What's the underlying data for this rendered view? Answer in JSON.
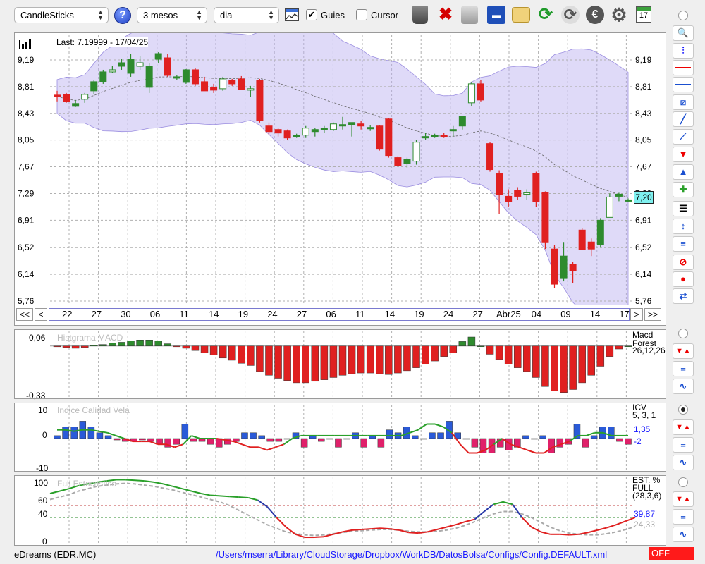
{
  "toolbar": {
    "chart_type": "CandleSticks",
    "help_icon_label": "?",
    "period": "3 mesos",
    "interval": "dia",
    "guides_label": "Guies",
    "guides_checked": true,
    "cursor_label": "Cursor",
    "cursor_checked": false,
    "calendar_day": "17"
  },
  "main_chart": {
    "last_label": "Last: 7.19999 - 17/04/25",
    "current_value": "7,20",
    "y_ticks": [
      "9,19",
      "8,81",
      "8,43",
      "8,05",
      "7,67",
      "7,29",
      "6,91",
      "6,52",
      "6,14",
      "5,76"
    ],
    "x_ticks": [
      "22",
      "27",
      "30",
      "06",
      "11",
      "14",
      "19",
      "24",
      "27",
      "06",
      "11",
      "14",
      "19",
      "24",
      "27",
      "Abr25",
      "04",
      "09",
      "14",
      "17"
    ],
    "nav": {
      "first": "<<",
      "prev": "<",
      "next": ">",
      "last": ">>"
    }
  },
  "macd": {
    "title": "Histgrama MACD",
    "y_top": "0,06",
    "y_bottom": "-0,33",
    "side_name": "Macd\nForest",
    "side_params": "26,12,26"
  },
  "icv": {
    "title": "Indice Calidad Vela",
    "y_top": "10",
    "y_mid": "0",
    "y_bottom": "-10",
    "side_name": "ICV",
    "side_params": "5, 3, 1",
    "value1": "1,35",
    "value2": "-2"
  },
  "stoch": {
    "title": "Full Estocastico",
    "y_ticks": [
      "100",
      "60",
      "40",
      "0"
    ],
    "side_name": "EST. %",
    "side_name2": "FULL",
    "side_params": "(28,3,6)",
    "value1": "39,87",
    "value2": "24,33"
  },
  "status": {
    "ticker": "eDreams (EDR.MC)",
    "path": "/Users/mserra/Library/CloudStorage/Dropbox/WorkDB/DatosBolsa/Configs/Config.DEFAULT.xml",
    "off_label": "OFF"
  },
  "colors": {
    "up": "#2e8b2e",
    "down": "#e02020",
    "band": "#b9aef0",
    "accent_blue": "#1a1aff"
  },
  "chart_data": [
    {
      "type": "candlestick",
      "title": "",
      "ylim": [
        5.76,
        9.37
      ],
      "candles": [
        [
          8.69,
          8.75,
          8.6,
          8.67
        ],
        [
          8.7,
          8.72,
          8.58,
          8.6
        ],
        [
          8.53,
          8.62,
          8.52,
          8.57
        ],
        [
          8.63,
          8.72,
          8.58,
          8.7
        ],
        [
          8.75,
          8.9,
          8.7,
          8.88
        ],
        [
          8.88,
          9.05,
          8.85,
          9.02
        ],
        [
          9.02,
          9.1,
          9.0,
          9.05
        ],
        [
          9.1,
          9.2,
          9.05,
          9.15
        ],
        [
          9.0,
          9.28,
          8.95,
          9.2
        ],
        [
          9.1,
          9.25,
          9.05,
          9.15
        ],
        [
          8.8,
          9.15,
          8.72,
          9.1
        ],
        [
          9.2,
          9.3,
          9.15,
          9.28
        ],
        [
          9.22,
          9.27,
          8.95,
          8.97
        ],
        [
          8.94,
          8.97,
          8.9,
          8.95
        ],
        [
          8.87,
          9.06,
          8.85,
          9.05
        ],
        [
          9.05,
          9.07,
          8.82,
          8.85
        ],
        [
          8.88,
          8.95,
          8.75,
          8.75
        ],
        [
          8.8,
          8.85,
          8.72,
          8.76
        ],
        [
          8.78,
          8.95,
          8.75,
          8.92
        ],
        [
          8.9,
          8.92,
          8.82,
          8.85
        ],
        [
          8.92,
          8.96,
          8.76,
          8.77
        ],
        [
          8.78,
          8.82,
          8.66,
          8.78
        ],
        [
          8.9,
          8.92,
          8.3,
          8.33
        ],
        [
          8.25,
          8.3,
          8.12,
          8.17
        ],
        [
          8.2,
          8.22,
          8.1,
          8.15
        ],
        [
          8.18,
          8.2,
          8.05,
          8.08
        ],
        [
          8.12,
          8.14,
          8.08,
          8.12
        ],
        [
          8.12,
          8.25,
          8.08,
          8.22
        ],
        [
          8.17,
          8.22,
          8.1,
          8.2
        ],
        [
          8.22,
          8.25,
          8.15,
          8.22
        ],
        [
          8.2,
          8.3,
          8.18,
          8.28
        ],
        [
          8.25,
          8.38,
          8.2,
          8.27
        ],
        [
          8.27,
          8.3,
          8.1,
          8.3
        ],
        [
          8.28,
          8.32,
          8.2,
          8.25
        ],
        [
          8.23,
          8.26,
          8.18,
          8.23
        ],
        [
          8.25,
          8.26,
          7.9,
          7.92
        ],
        [
          8.35,
          8.36,
          7.8,
          7.83
        ],
        [
          7.8,
          7.82,
          7.69,
          7.69
        ],
        [
          7.72,
          7.8,
          7.65,
          7.78
        ],
        [
          7.75,
          8.05,
          7.7,
          8.02
        ],
        [
          8.08,
          8.15,
          8.05,
          8.1
        ],
        [
          8.12,
          8.14,
          8.08,
          8.12
        ],
        [
          8.12,
          8.15,
          8.08,
          8.1
        ],
        [
          8.18,
          8.25,
          8.1,
          8.2
        ],
        [
          8.25,
          8.38,
          8.2,
          8.39
        ],
        [
          8.58,
          8.88,
          8.53,
          8.85
        ],
        [
          8.85,
          8.9,
          8.6,
          8.62
        ],
        [
          8.0,
          8.02,
          7.6,
          7.63
        ],
        [
          7.57,
          7.62,
          7.0,
          7.27
        ],
        [
          7.25,
          7.35,
          7.1,
          7.17
        ],
        [
          7.33,
          7.38,
          7.2,
          7.25
        ],
        [
          7.3,
          7.35,
          7.2,
          7.3
        ],
        [
          7.58,
          7.6,
          7.1,
          7.17
        ],
        [
          7.3,
          7.32,
          6.5,
          6.6
        ],
        [
          6.5,
          6.56,
          5.95,
          6.0
        ],
        [
          6.08,
          6.6,
          6.04,
          6.4
        ],
        [
          6.28,
          6.32,
          6.02,
          6.19
        ],
        [
          6.77,
          6.8,
          6.5,
          6.49
        ],
        [
          6.6,
          6.65,
          6.4,
          6.5
        ],
        [
          6.56,
          6.94,
          6.52,
          6.91
        ],
        [
          6.95,
          7.29,
          6.95,
          7.24
        ],
        [
          7.25,
          7.3,
          7.18,
          7.28
        ],
        [
          7.2,
          7.22,
          7.17,
          7.2
        ]
      ]
    },
    {
      "type": "bar",
      "title": "Histgrama MACD",
      "ylim": [
        -0.33,
        0.06
      ],
      "values": [
        -0.005,
        -0.01,
        -0.015,
        -0.01,
        0.005,
        0.01,
        0.02,
        0.025,
        0.035,
        0.04,
        0.04,
        0.035,
        0.015,
        -0.005,
        -0.015,
        -0.03,
        -0.045,
        -0.06,
        -0.08,
        -0.095,
        -0.115,
        -0.13,
        -0.17,
        -0.195,
        -0.215,
        -0.23,
        -0.245,
        -0.245,
        -0.235,
        -0.225,
        -0.21,
        -0.195,
        -0.185,
        -0.18,
        -0.18,
        -0.185,
        -0.19,
        -0.18,
        -0.165,
        -0.145,
        -0.12,
        -0.1,
        -0.07,
        -0.045,
        0.03,
        0.06,
        0.0,
        -0.055,
        -0.09,
        -0.12,
        -0.145,
        -0.17,
        -0.21,
        -0.27,
        -0.3,
        -0.31,
        -0.29,
        -0.245,
        -0.195,
        -0.135,
        -0.07,
        -0.02,
        0.0
      ]
    },
    {
      "type": "bar",
      "title": "Indice Calidad Vela",
      "ylim": [
        -10,
        10
      ],
      "values": [
        1,
        4,
        4,
        6,
        4,
        2,
        1,
        -0.5,
        -1,
        -1,
        -0.5,
        -1,
        -2,
        -3,
        -2,
        5,
        -1,
        -1,
        -2,
        -3,
        -2,
        -1,
        2,
        2,
        1,
        -1,
        -1,
        0,
        2,
        -3,
        1,
        -1,
        0,
        -3,
        0,
        2,
        -3,
        1,
        -3,
        3,
        2,
        4,
        1,
        0,
        2,
        2,
        6,
        2,
        0,
        -3,
        -5,
        -5,
        -3,
        -4,
        -3,
        1,
        0,
        1,
        -5,
        -3,
        -2,
        5,
        -3,
        1,
        4,
        4,
        -1,
        -2
      ],
      "series_k": [
        3,
        3,
        2.5,
        3,
        3,
        2.5,
        2,
        1,
        0,
        -1,
        -1,
        -1,
        -2,
        -2,
        -3,
        -2,
        1,
        0,
        0,
        0,
        -0.5,
        -1,
        -2,
        -3,
        -3,
        -4,
        -3,
        -2,
        0,
        1,
        1,
        1,
        1,
        1,
        1,
        1,
        1,
        1,
        1,
        1,
        1,
        1,
        2,
        3,
        5,
        5,
        4,
        2,
        -2,
        -5,
        -5,
        -4,
        -2,
        0,
        -2,
        -3,
        -4,
        -5,
        -5,
        -3,
        -2,
        -1,
        1,
        1,
        2,
        2,
        1,
        1,
        1
      ]
    },
    {
      "type": "line",
      "title": "Full Estocastico",
      "ylim": [
        0,
        100
      ],
      "series": [
        {
          "values": [
            80,
            84,
            88,
            93,
            96,
            99,
            101,
            103,
            103,
            102,
            101,
            99,
            96,
            92,
            88,
            84,
            80,
            77,
            76,
            75,
            74,
            73,
            69,
            58,
            40,
            24,
            12,
            7,
            7,
            8,
            12,
            16,
            19,
            20,
            21,
            22,
            21,
            19,
            15,
            14,
            16,
            20,
            24,
            28,
            33,
            37,
            50,
            62,
            66,
            62,
            40,
            24,
            16,
            12,
            12,
            11,
            12,
            15,
            19,
            23,
            28,
            34,
            40
          ]
        },
        {
          "values": [
            70,
            74,
            78,
            84,
            88,
            92,
            94,
            96,
            97,
            96,
            94,
            92,
            89,
            86,
            82,
            78,
            74,
            70,
            66,
            60,
            52,
            44,
            36,
            28,
            22,
            16,
            13,
            11,
            10,
            11,
            13,
            15,
            17,
            18,
            19,
            20,
            20,
            19,
            17,
            16,
            16,
            17,
            19,
            22,
            27,
            33,
            40,
            46,
            50,
            50,
            46,
            40,
            32,
            24,
            18,
            14,
            12,
            11,
            11,
            13,
            16,
            20,
            25
          ]
        }
      ]
    }
  ]
}
